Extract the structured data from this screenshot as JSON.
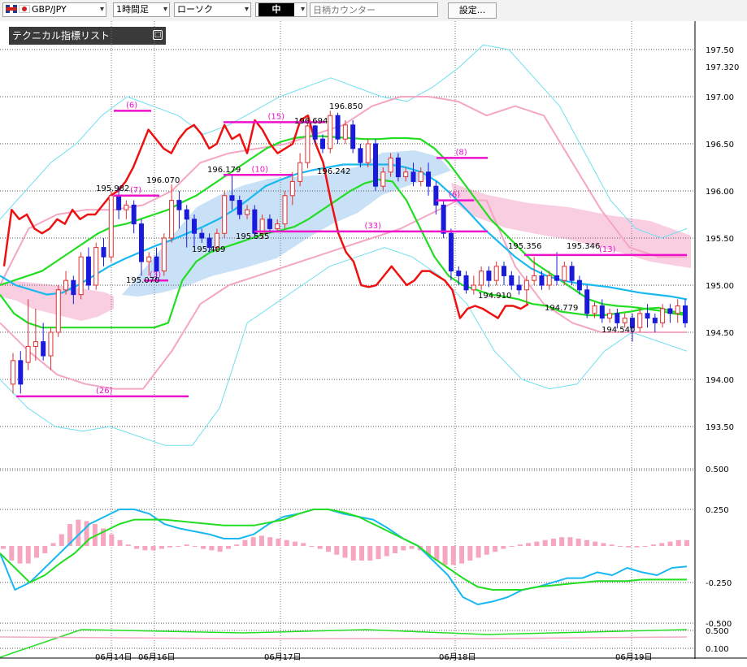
{
  "toolbar": {
    "symbol": "GBP/JPY",
    "timeframe": "1時間足",
    "chart_type": "ローソク",
    "size_label": "中",
    "search_placeholder": "日柄カウンター",
    "settings_label": "設定..."
  },
  "panel": {
    "title": "テクニカル指標リスト",
    "toggle": "□"
  },
  "colors": {
    "bull": "#e03030",
    "bear": "#1a1adb",
    "red_line": "#ee1111",
    "green": "#22dd22",
    "cyan": "#1ab8f0",
    "pink": "#f4a6c4",
    "light_cyan": "#6fdff0",
    "magenta": "#ee11cc",
    "cloud_blue": "#bfdcf5",
    "cloud_pink": "#f9c9de"
  },
  "chart_data": {
    "type": "candlestick",
    "price_axis_ticks": [
      "197.50",
      "197.320",
      "197.00",
      "196.50",
      "196.00",
      "195.50",
      "195.00",
      "194.50",
      "194.00",
      "193.50"
    ],
    "osc_axis_ticks": [
      "0.500",
      "0.250",
      "-0.250",
      "-0.500"
    ],
    "sub_axis_ticks": [
      "0.500",
      "0.100"
    ],
    "x_labels": [
      "06月14日",
      "06月16日",
      "06月17日",
      "06月18日",
      "06月19日"
    ],
    "price_annotations": [
      "195.982",
      "196.070",
      "195.070",
      "196.179",
      "195.409",
      "195.555",
      "196.694",
      "196.850",
      "196.242",
      "194.910",
      "195.356",
      "194.779",
      "195.346",
      "194.540"
    ],
    "count_labels": [
      "(6)",
      "(7)",
      "(3)",
      "(26)",
      "(15)",
      "(10)",
      "(33)",
      "(8)",
      "(6)",
      "(13)"
    ],
    "last_price": "197.320",
    "candles": [
      [
        193.95,
        194.2,
        193.85,
        194.28
      ],
      [
        194.2,
        193.95,
        193.85,
        194.3
      ],
      [
        194.18,
        194.35,
        194.1,
        194.85
      ],
      [
        194.35,
        194.4,
        194.2,
        194.75
      ],
      [
        194.4,
        194.25,
        194.2,
        194.6
      ],
      [
        194.25,
        194.5,
        194.1,
        194.55
      ],
      [
        194.5,
        194.95,
        194.45,
        195.0
      ],
      [
        194.95,
        195.05,
        194.9,
        195.15
      ],
      [
        195.05,
        194.9,
        194.8,
        195.1
      ],
      [
        194.9,
        195.3,
        194.85,
        195.35
      ],
      [
        195.3,
        195.0,
        194.95,
        195.4
      ],
      [
        195.0,
        195.4,
        194.95,
        195.45
      ],
      [
        195.4,
        195.3,
        195.2,
        195.5
      ],
      [
        195.3,
        195.95,
        195.25,
        196.0
      ],
      [
        195.95,
        195.8,
        195.7,
        196.05
      ],
      [
        195.8,
        195.85,
        195.7,
        195.9
      ],
      [
        195.85,
        195.65,
        195.55,
        195.9
      ],
      [
        195.65,
        195.25,
        195.1,
        195.7
      ],
      [
        195.25,
        195.3,
        195.1,
        195.35
      ],
      [
        195.3,
        195.15,
        195.05,
        195.4
      ],
      [
        195.15,
        195.5,
        195.1,
        195.55
      ],
      [
        195.5,
        195.9,
        195.45,
        196.07
      ],
      [
        195.9,
        195.8,
        195.6,
        196.0
      ],
      [
        195.8,
        195.7,
        195.4,
        195.85
      ],
      [
        195.7,
        195.55,
        195.4,
        195.75
      ],
      [
        195.55,
        195.5,
        195.45,
        195.6
      ],
      [
        195.5,
        195.4,
        195.35,
        195.55
      ],
      [
        195.4,
        195.55,
        195.35,
        195.6
      ],
      [
        195.55,
        195.95,
        195.5,
        196.0
      ],
      [
        195.95,
        195.9,
        195.8,
        196.18
      ],
      [
        195.9,
        195.75,
        195.7,
        195.95
      ],
      [
        195.75,
        195.8,
        195.7,
        195.85
      ],
      [
        195.8,
        195.55,
        195.5,
        195.85
      ],
      [
        195.55,
        195.7,
        195.5,
        195.75
      ],
      [
        195.7,
        195.6,
        195.55,
        195.75
      ],
      [
        195.6,
        195.65,
        195.56,
        195.7
      ],
      [
        195.65,
        195.95,
        195.6,
        196.0
      ],
      [
        195.95,
        196.1,
        195.85,
        196.2
      ],
      [
        196.1,
        196.3,
        196.05,
        196.4
      ],
      [
        196.3,
        196.69,
        196.24,
        196.75
      ],
      [
        196.69,
        196.55,
        196.5,
        196.7
      ],
      [
        196.55,
        196.45,
        196.4,
        196.6
      ],
      [
        196.45,
        196.8,
        196.4,
        196.85
      ],
      [
        196.8,
        196.55,
        196.5,
        196.83
      ],
      [
        196.55,
        196.7,
        196.5,
        196.75
      ],
      [
        196.7,
        196.45,
        196.4,
        196.75
      ],
      [
        196.45,
        196.3,
        196.25,
        196.5
      ],
      [
        196.3,
        196.5,
        196.25,
        196.55
      ],
      [
        196.5,
        196.05,
        196.0,
        196.55
      ],
      [
        196.05,
        196.2,
        196.0,
        196.25
      ],
      [
        196.2,
        196.35,
        196.15,
        196.4
      ],
      [
        196.35,
        196.15,
        196.1,
        196.4
      ],
      [
        196.15,
        196.2,
        196.1,
        196.25
      ],
      [
        196.2,
        196.1,
        196.05,
        196.3
      ],
      [
        196.1,
        196.2,
        196.05,
        196.25
      ],
      [
        196.2,
        196.05,
        195.95,
        196.3
      ],
      [
        196.05,
        195.85,
        195.75,
        196.1
      ],
      [
        195.85,
        195.55,
        195.5,
        195.9
      ],
      [
        195.55,
        195.15,
        195.05,
        195.6
      ],
      [
        195.15,
        195.1,
        195.0,
        195.2
      ],
      [
        195.1,
        194.95,
        194.91,
        195.15
      ],
      [
        194.95,
        195.0,
        194.9,
        195.1
      ],
      [
        195.0,
        195.15,
        194.95,
        195.2
      ],
      [
        195.15,
        195.05,
        194.98,
        195.2
      ],
      [
        195.05,
        195.2,
        195.0,
        195.25
      ],
      [
        195.2,
        195.1,
        195.0,
        195.25
      ],
      [
        195.1,
        195.0,
        194.95,
        195.15
      ],
      [
        195.0,
        194.95,
        194.9,
        195.1
      ],
      [
        194.95,
        195.05,
        194.78,
        195.1
      ],
      [
        195.05,
        195.1,
        195.0,
        195.3
      ],
      [
        195.1,
        195.0,
        194.95,
        195.15
      ],
      [
        195.0,
        195.1,
        194.95,
        195.15
      ],
      [
        195.1,
        195.05,
        195.0,
        195.35
      ],
      [
        195.05,
        195.2,
        195.0,
        195.25
      ],
      [
        195.2,
        195.05,
        195.0,
        195.25
      ],
      [
        195.05,
        194.95,
        194.9,
        195.1
      ],
      [
        194.95,
        194.7,
        194.65,
        195.0
      ],
      [
        194.7,
        194.78,
        194.65,
        194.82
      ],
      [
        194.78,
        194.65,
        194.6,
        194.85
      ],
      [
        194.65,
        194.7,
        194.6,
        194.75
      ],
      [
        194.7,
        194.6,
        194.54,
        194.75
      ],
      [
        194.6,
        194.65,
        194.55,
        194.7
      ],
      [
        194.65,
        194.55,
        194.4,
        194.7
      ],
      [
        194.55,
        194.7,
        194.5,
        194.75
      ],
      [
        194.7,
        194.65,
        194.55,
        194.8
      ],
      [
        194.65,
        194.6,
        194.5,
        194.7
      ],
      [
        194.6,
        194.75,
        194.55,
        194.8
      ],
      [
        194.75,
        194.7,
        194.6,
        194.8
      ],
      [
        194.7,
        194.78,
        194.6,
        194.85
      ],
      [
        194.78,
        194.6,
        194.55,
        194.85
      ]
    ],
    "upper_line": [
      195.2,
      195.8,
      195.7,
      195.75,
      195.6,
      195.55,
      195.6,
      195.7,
      195.65,
      195.8,
      195.7,
      195.75,
      195.75,
      195.85,
      195.95,
      196.0,
      196.1,
      196.25,
      196.45,
      196.65,
      196.55,
      196.45,
      196.4,
      196.55,
      196.65,
      196.7,
      196.6,
      196.45,
      196.5,
      196.7,
      196.55,
      196.6,
      196.4,
      196.75,
      196.65,
      196.5,
      196.4,
      196.45,
      196.5,
      196.75,
      196.8,
      196.5,
      196.3,
      195.9,
      195.55,
      195.35,
      195.25,
      195.0,
      194.98,
      195.0,
      195.1,
      195.2,
      195.1,
      195.0,
      195.05,
      195.15,
      195.15,
      195.1,
      195.05,
      194.95,
      194.65,
      194.75,
      194.78,
      194.75,
      194.7,
      194.65,
      194.78,
      194.78,
      194.75,
      194.8
    ],
    "green_upper": [
      195.0,
      195.05,
      195.1,
      195.15,
      195.25,
      195.35,
      195.45,
      195.55,
      195.62,
      195.65,
      195.7,
      195.75,
      195.8,
      195.88,
      195.95,
      196.05,
      196.15,
      196.25,
      196.35,
      196.45,
      196.52,
      196.56,
      196.58,
      196.58,
      196.57,
      196.56,
      196.55,
      196.55,
      196.56,
      196.56,
      196.55,
      196.45,
      196.3,
      196.1,
      195.9,
      195.7,
      195.55,
      195.4,
      195.25,
      195.15,
      195.05,
      194.95,
      194.85,
      194.8,
      194.78,
      194.77,
      194.75,
      194.73,
      194.7,
      194.68
    ],
    "cyan_mid": [
      195.1,
      195.0,
      194.95,
      194.9,
      194.92,
      195.0,
      195.1,
      195.2,
      195.28,
      195.35,
      195.42,
      195.48,
      195.55,
      195.62,
      195.7,
      195.8,
      195.92,
      196.05,
      196.12,
      196.18,
      196.22,
      196.25,
      196.28,
      196.28,
      196.28,
      196.28,
      196.25,
      196.2,
      196.1,
      195.95,
      195.78,
      195.6,
      195.45,
      195.3,
      195.18,
      195.1,
      195.05,
      195.02,
      195.0,
      194.98,
      194.95,
      194.92,
      194.9,
      194.88,
      194.85
    ],
    "green_lower": [
      194.9,
      194.7,
      194.6,
      194.55,
      194.55,
      194.55,
      194.55,
      194.55,
      194.55,
      194.55,
      194.55,
      194.55,
      194.6,
      195.05,
      195.25,
      195.35,
      195.4,
      195.45,
      195.5,
      195.55,
      195.58,
      195.62,
      195.7,
      195.8,
      195.9,
      196.0,
      196.08,
      196.12,
      196.1,
      195.9,
      195.6,
      195.3,
      195.1,
      195.0,
      194.95,
      194.9,
      194.88,
      194.85,
      194.8,
      194.78,
      194.72,
      194.7,
      194.68,
      194.68,
      194.7,
      194.72,
      194.75,
      194.76,
      194.72,
      194.7
    ],
    "osc_histogram": [
      -0.02,
      -0.1,
      -0.12,
      -0.12,
      -0.08,
      -0.05,
      0.02,
      0.08,
      0.15,
      0.18,
      0.17,
      0.15,
      0.12,
      0.08,
      0.04,
      0.01,
      -0.02,
      -0.03,
      -0.03,
      -0.02,
      -0.01,
      0.0,
      0.01,
      0.0,
      -0.02,
      -0.03,
      -0.04,
      -0.02,
      0.01,
      0.04,
      0.06,
      0.07,
      0.06,
      0.05,
      0.04,
      0.03,
      0.02,
      0.0,
      -0.02,
      -0.04,
      -0.06,
      -0.08,
      -0.1,
      -0.1,
      -0.1,
      -0.09,
      -0.07,
      -0.05,
      -0.03,
      -0.02,
      -0.03,
      -0.06,
      -0.1,
      -0.13,
      -0.13,
      -0.12,
      -0.1,
      -0.08,
      -0.06,
      -0.04,
      -0.02,
      0.0,
      0.01,
      0.02,
      0.03,
      0.04,
      0.05,
      0.06,
      0.06,
      0.05,
      0.04,
      0.03,
      0.02,
      0.01,
      0.0,
      -0.01,
      -0.01,
      0.0,
      0.01,
      0.02,
      0.03,
      0.04,
      0.04
    ],
    "osc_fast": [
      -0.05,
      -0.3,
      -0.25,
      -0.15,
      -0.05,
      0.05,
      0.15,
      0.2,
      0.25,
      0.25,
      0.22,
      0.15,
      0.12,
      0.1,
      0.08,
      0.05,
      0.05,
      0.08,
      0.15,
      0.2,
      0.22,
      0.25,
      0.25,
      0.22,
      0.2,
      0.18,
      0.12,
      0.05,
      0.0,
      -0.1,
      -0.2,
      -0.35,
      -0.4,
      -0.38,
      -0.35,
      -0.3,
      -0.28,
      -0.25,
      -0.22,
      -0.22,
      -0.18,
      -0.2,
      -0.15,
      -0.18,
      -0.2,
      -0.15,
      -0.14
    ],
    "osc_slow": [
      -0.05,
      -0.15,
      -0.25,
      -0.2,
      -0.12,
      -0.05,
      0.05,
      0.1,
      0.15,
      0.18,
      0.18,
      0.18,
      0.17,
      0.16,
      0.15,
      0.14,
      0.14,
      0.14,
      0.16,
      0.18,
      0.22,
      0.25,
      0.25,
      0.23,
      0.2,
      0.15,
      0.1,
      0.05,
      0.0,
      -0.08,
      -0.15,
      -0.22,
      -0.28,
      -0.3,
      -0.3,
      -0.3,
      -0.28,
      -0.27,
      -0.26,
      -0.25,
      -0.24,
      -0.24,
      -0.24,
      -0.23,
      -0.23,
      -0.23,
      -0.23
    ],
    "horizontal_levels": [
      {
        "label": "(6)",
        "price": 196.85
      },
      {
        "label": "(7)",
        "price": 195.95
      },
      {
        "label": "(3)",
        "price": 195.05
      },
      {
        "label": "(26)",
        "price": 193.82
      },
      {
        "label": "(15)",
        "price": 196.73
      },
      {
        "label": "(10)",
        "price": 196.17
      },
      {
        "label": "(33)",
        "price": 195.57
      },
      {
        "label": "(8)",
        "price": 196.35
      },
      {
        "label": "(6)",
        "price": 195.9
      },
      {
        "label": "(13)",
        "price": 195.32
      }
    ]
  }
}
